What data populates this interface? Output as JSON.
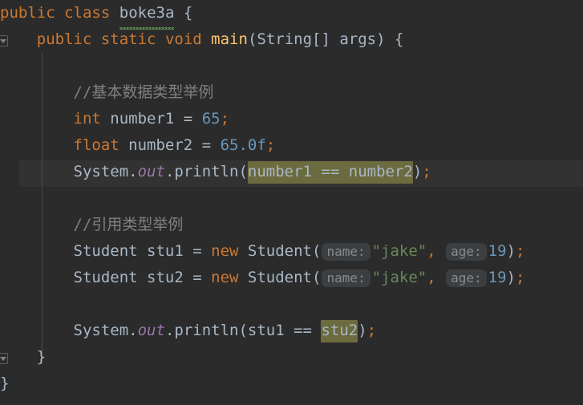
{
  "editor": {
    "language": "Java",
    "colors": {
      "background": "#2b2b2b",
      "current_line_background": "#323232",
      "default_text": "#a9b7c6",
      "keyword": "#cc7832",
      "method": "#ffc66d",
      "number": "#6897bb",
      "string": "#6a8759",
      "comment": "#808080",
      "static_field": "#9876aa",
      "selection_highlight": "#6b6b3f",
      "inlay_hint_background": "#3c3f41",
      "inlay_hint_text": "#868a8c",
      "indent_guide": "#4b4b4b",
      "error_squiggle": "#629755"
    },
    "current_line_number": 6,
    "fold_markers": [
      {
        "name": "fold-marker-class",
        "line": 1
      },
      {
        "name": "fold-marker-method",
        "line": 2
      },
      {
        "name": "fold-marker-method-end",
        "line": 13
      }
    ],
    "lines": [
      {
        "n": 1,
        "tokens": [
          {
            "t": "public",
            "c": "kw"
          },
          {
            "t": " ",
            "c": "plain"
          },
          {
            "t": "class",
            "c": "kw"
          },
          {
            "t": " ",
            "c": "plain"
          },
          {
            "t": "boke3a",
            "c": "cls",
            "squiggle": true
          },
          {
            "t": " ",
            "c": "plain"
          },
          {
            "t": "{",
            "c": "brace"
          }
        ]
      },
      {
        "n": 2,
        "tokens": [
          {
            "t": "    ",
            "c": "plain"
          },
          {
            "t": "public",
            "c": "kw"
          },
          {
            "t": " ",
            "c": "plain"
          },
          {
            "t": "static",
            "c": "kw"
          },
          {
            "t": " ",
            "c": "plain"
          },
          {
            "t": "void",
            "c": "kw"
          },
          {
            "t": " ",
            "c": "plain"
          },
          {
            "t": "main",
            "c": "mthd"
          },
          {
            "t": "(",
            "c": "brace"
          },
          {
            "t": "String",
            "c": "type"
          },
          {
            "t": "[] ",
            "c": "plain"
          },
          {
            "t": "args",
            "c": "plain"
          },
          {
            "t": ") ",
            "c": "brace"
          },
          {
            "t": "{",
            "c": "brace"
          }
        ]
      },
      {
        "n": 3,
        "tokens": []
      },
      {
        "n": 4,
        "tokens": [
          {
            "t": "        ",
            "c": "plain"
          },
          {
            "t": "//基本数据类型举例",
            "c": "cmt"
          }
        ]
      },
      {
        "n": 5,
        "tokens": [
          {
            "t": "        ",
            "c": "plain"
          },
          {
            "t": "int",
            "c": "kw"
          },
          {
            "t": " number1 ",
            "c": "plain"
          },
          {
            "t": "= ",
            "c": "plain"
          },
          {
            "t": "65",
            "c": "num"
          },
          {
            "t": ";",
            "c": "semi"
          }
        ]
      },
      {
        "n": 6,
        "tokens": [
          {
            "t": "        ",
            "c": "plain"
          },
          {
            "t": "float",
            "c": "kw"
          },
          {
            "t": " number2 ",
            "c": "plain"
          },
          {
            "t": "= ",
            "c": "plain"
          },
          {
            "t": "65.0f",
            "c": "num"
          },
          {
            "t": ";",
            "c": "semi"
          }
        ]
      },
      {
        "n": 7,
        "current": true,
        "tokens": [
          {
            "t": "        ",
            "c": "plain"
          },
          {
            "t": "System",
            "c": "cls"
          },
          {
            "t": ".",
            "c": "plain"
          },
          {
            "t": "out",
            "c": "field"
          },
          {
            "t": ".",
            "c": "plain"
          },
          {
            "t": "println",
            "c": "plain"
          },
          {
            "t": "(",
            "c": "brace"
          },
          {
            "t": "number1 == number2",
            "c": "plain",
            "hl": true
          },
          {
            "t": ")",
            "c": "brace"
          },
          {
            "t": ";",
            "c": "semi"
          }
        ]
      },
      {
        "n": 8,
        "tokens": []
      },
      {
        "n": 9,
        "tokens": [
          {
            "t": "        ",
            "c": "plain"
          },
          {
            "t": "//引用类型举例",
            "c": "cmt"
          }
        ]
      },
      {
        "n": 10,
        "tokens": [
          {
            "t": "        ",
            "c": "plain"
          },
          {
            "t": "Student",
            "c": "cls"
          },
          {
            "t": " stu1 ",
            "c": "plain"
          },
          {
            "t": "= ",
            "c": "plain"
          },
          {
            "t": "new",
            "c": "kw"
          },
          {
            "t": " ",
            "c": "plain"
          },
          {
            "t": "Student",
            "c": "cls"
          },
          {
            "t": "(",
            "c": "brace"
          },
          {
            "t": "name:",
            "hint": true
          },
          {
            "t": "\"jake\"",
            "c": "str"
          },
          {
            "t": ", ",
            "c": "semi"
          },
          {
            "t": "age:",
            "hint": true
          },
          {
            "t": "19",
            "c": "num"
          },
          {
            "t": ")",
            "c": "brace"
          },
          {
            "t": ";",
            "c": "semi"
          }
        ]
      },
      {
        "n": 11,
        "tokens": [
          {
            "t": "        ",
            "c": "plain"
          },
          {
            "t": "Student",
            "c": "cls"
          },
          {
            "t": " stu2 ",
            "c": "plain"
          },
          {
            "t": "= ",
            "c": "plain"
          },
          {
            "t": "new",
            "c": "kw"
          },
          {
            "t": " ",
            "c": "plain"
          },
          {
            "t": "Student",
            "c": "cls"
          },
          {
            "t": "(",
            "c": "brace"
          },
          {
            "t": "name:",
            "hint": true
          },
          {
            "t": "\"jake\"",
            "c": "str"
          },
          {
            "t": ", ",
            "c": "semi"
          },
          {
            "t": "age:",
            "hint": true
          },
          {
            "t": "19",
            "c": "num"
          },
          {
            "t": ")",
            "c": "brace"
          },
          {
            "t": ";",
            "c": "semi"
          }
        ]
      },
      {
        "n": 12,
        "tokens": []
      },
      {
        "n": 13,
        "tokens": [
          {
            "t": "        ",
            "c": "plain"
          },
          {
            "t": "System",
            "c": "cls"
          },
          {
            "t": ".",
            "c": "plain"
          },
          {
            "t": "out",
            "c": "field"
          },
          {
            "t": ".",
            "c": "plain"
          },
          {
            "t": "println",
            "c": "plain"
          },
          {
            "t": "(",
            "c": "brace"
          },
          {
            "t": "stu1 == ",
            "c": "plain"
          },
          {
            "t": "stu2",
            "c": "plain",
            "hl": true
          },
          {
            "t": ")",
            "c": "brace"
          },
          {
            "t": ";",
            "c": "semi"
          }
        ]
      },
      {
        "n": 14,
        "tokens": [
          {
            "t": "    ",
            "c": "plain"
          },
          {
            "t": "}",
            "c": "brace"
          }
        ]
      },
      {
        "n": 15,
        "tokens": [
          {
            "t": "}",
            "c": "brace"
          }
        ]
      }
    ]
  }
}
